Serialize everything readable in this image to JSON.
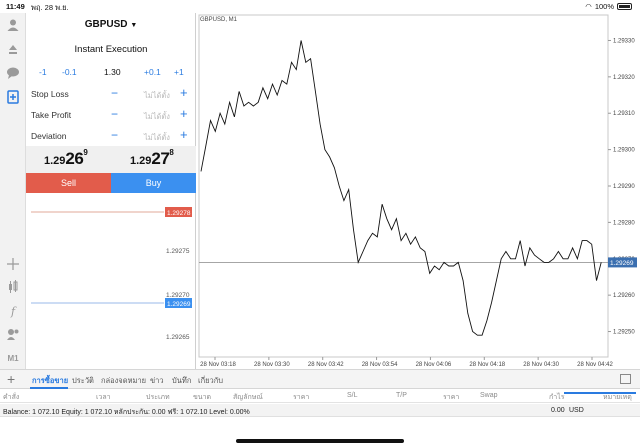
{
  "status_bar": {
    "time": "11:49",
    "date": "พฤ. 28 พ.ย.",
    "battery": "100%"
  },
  "symbol": "GBPUSD",
  "execution_type": "Instant Execution",
  "volume_steps": {
    "minus1": "-1",
    "minus01": "-0.1",
    "volume": "1.30",
    "plus01": "+0.1",
    "plus1": "+1"
  },
  "fields": [
    {
      "label": "Stop Loss",
      "value": "ไม่ได้ตั้ง"
    },
    {
      "label": "Take Profit",
      "value": "ไม่ได้ตั้ง"
    },
    {
      "label": "Deviation",
      "value": "ไม่ได้ตั้ง"
    }
  ],
  "bid": {
    "prefix": "1.29",
    "big": "26",
    "sup": "9"
  },
  "ask": {
    "prefix": "1.29",
    "big": "27",
    "sup": "8"
  },
  "sell_label": "Sell",
  "buy_label": "Buy",
  "depth": {
    "ask_price": "1.29278",
    "bid_price": "1.29269",
    "levels": [
      "1.29275",
      "1.29270",
      "1.29265"
    ]
  },
  "chart_data": {
    "type": "line",
    "title": "GBPUSD, M1",
    "y_ticks": [
      "1.29330",
      "1.29320",
      "1.29310",
      "1.29300",
      "1.29290",
      "1.29280",
      "1.29270",
      "1.29260",
      "1.29250"
    ],
    "x_ticks": [
      "28 Nov 03:18",
      "28 Nov 03:30",
      "28 Nov 03:42",
      "28 Nov 03:54",
      "28 Nov 04:06",
      "28 Nov 04:18",
      "28 Nov 04:30",
      "28 Nov 04:42"
    ],
    "ylim": [
      1.29243,
      1.29337
    ],
    "xlim": [
      0,
      85
    ],
    "current_price_label": "1.29269",
    "current_price": 1.29269,
    "values": [
      1.29294,
      1.29301,
      1.29308,
      1.29305,
      1.2931,
      1.29307,
      1.29313,
      1.29309,
      1.29316,
      1.29312,
      1.29313,
      1.29312,
      1.29313,
      1.29317,
      1.29314,
      1.29318,
      1.29315,
      1.29319,
      1.29318,
      1.29324,
      1.29322,
      1.2933,
      1.29324,
      1.29325,
      1.29316,
      1.29307,
      1.293,
      1.29298,
      1.29295,
      1.2929,
      1.29286,
      1.29289,
      1.29278,
      1.29269,
      1.29272,
      1.29275,
      1.29277,
      1.29276,
      1.29285,
      1.29281,
      1.29278,
      1.29281,
      1.29275,
      1.29277,
      1.29274,
      1.29276,
      1.29273,
      1.29272,
      1.29266,
      1.29268,
      1.29267,
      1.29269,
      1.29268,
      1.29268,
      1.29269,
      1.29264,
      1.29255,
      1.2925,
      1.29249,
      1.29249,
      1.29253,
      1.29258,
      1.29264,
      1.2927,
      1.29272,
      1.2927,
      1.2927,
      1.29275,
      1.29268,
      1.29273,
      1.29271,
      1.2927,
      1.29269,
      1.29269,
      1.2927,
      1.29272,
      1.2927,
      1.2927,
      1.29273,
      1.2927,
      1.29275,
      1.29275,
      1.29274,
      1.29264,
      1.29269
    ]
  },
  "bottom_tabs": [
    "การซื้อขาย",
    "ประวัติ",
    "กล่องจดหมาย",
    "ข่าว",
    "บันทึก",
    "เกี่ยวกับ"
  ],
  "columns": [
    "คำสั่ง",
    "เวลา",
    "ประเภท",
    "ขนาด",
    "สัญลักษณ์",
    "ราคา",
    "S/L",
    "T/P",
    "ราคา",
    "Swap",
    "กำไร",
    "หมายเหตุ"
  ],
  "balance": {
    "text": "Balance: 1 072.10 Equity: 1 072.10 หลักประกัน: 0.00 ฟรี: 1 072.10 Level: 0.00%",
    "profit": "0.00",
    "currency": "USD"
  },
  "colors": {
    "sell": "#e25c4b",
    "buy": "#3b90f0",
    "accent": "#2a7be0"
  }
}
